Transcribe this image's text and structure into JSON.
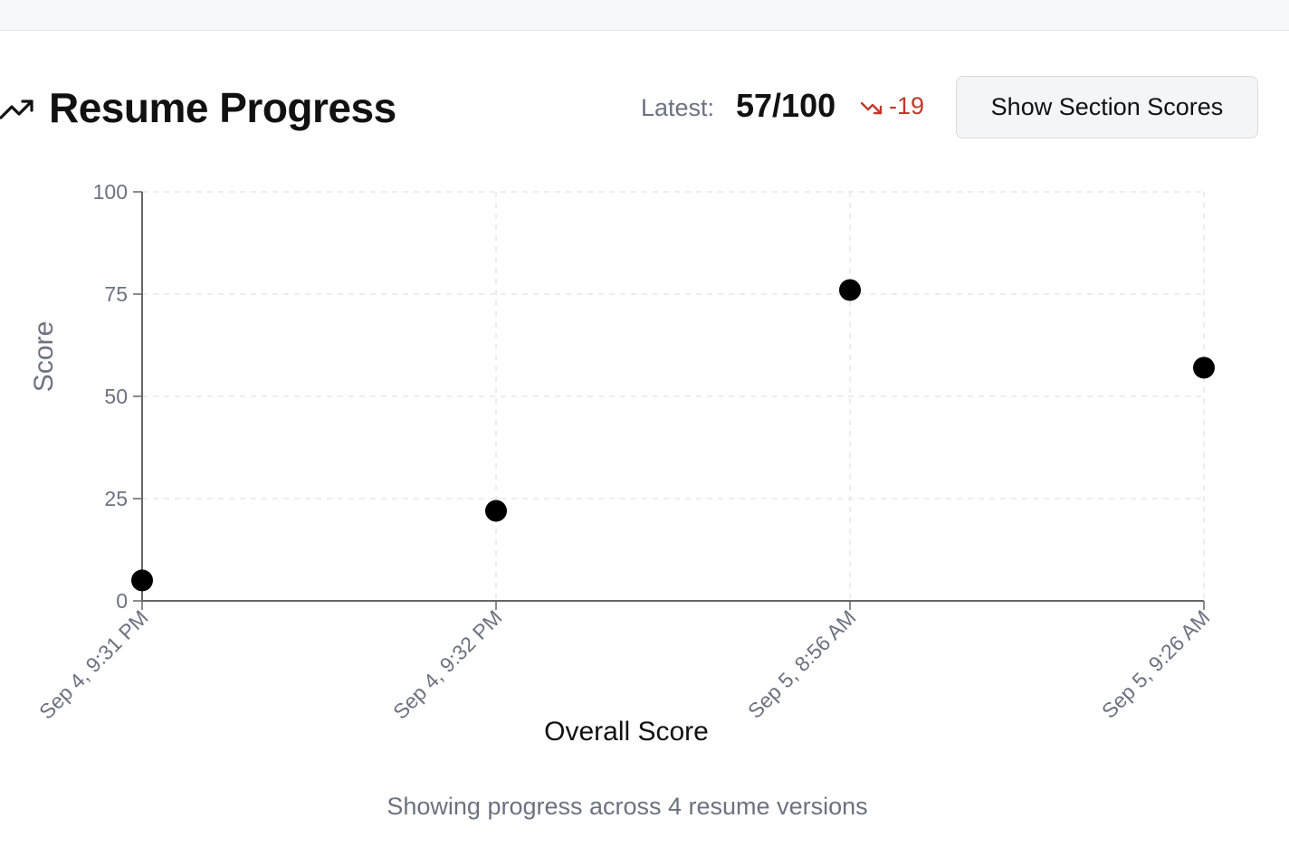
{
  "header": {
    "title": "Resume Progress",
    "latest_label": "Latest:",
    "latest_value": "57/100",
    "delta": "-19",
    "section_scores_button": "Show Section Scores",
    "title_icon": "trending-up-icon",
    "delta_icon": "trending-down-icon"
  },
  "colors": {
    "negative": "#c0392b",
    "points": "#000000",
    "grid": "#e5e7eb",
    "axis": "#666666",
    "muted_text": "#6b7280"
  },
  "chart_data": {
    "type": "scatter",
    "categories": [
      "Sep 4, 9:31 PM",
      "Sep 4, 9:32 PM",
      "Sep 5, 8:56 AM",
      "Sep 5, 9:26 AM"
    ],
    "values": [
      5,
      22,
      76,
      57
    ],
    "xlabel": "Overall Score",
    "ylabel": "Score",
    "ylim": [
      0,
      100
    ],
    "yticks": [
      "0",
      "25",
      "50",
      "75",
      "100"
    ],
    "grid": true,
    "grid_style": "dashed"
  },
  "footer": {
    "summary": "Showing progress across 4 resume versions"
  }
}
